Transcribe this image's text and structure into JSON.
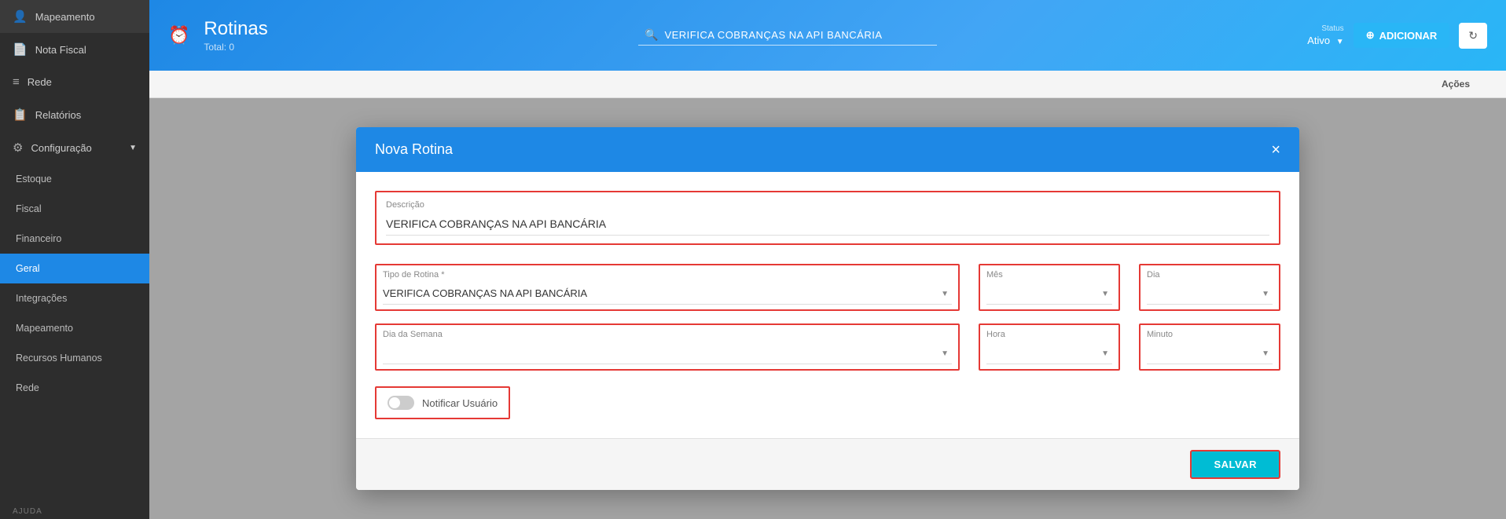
{
  "sidebar": {
    "items": [
      {
        "label": "Mapeamento",
        "icon": "👤",
        "id": "mapeamento-top"
      },
      {
        "label": "Nota Fiscal",
        "icon": "📄",
        "id": "nota-fiscal"
      },
      {
        "label": "Rede",
        "icon": "≡",
        "id": "rede-top"
      },
      {
        "label": "Relatórios",
        "icon": "📋",
        "id": "relatorios"
      },
      {
        "label": "Configuração",
        "icon": "⚙",
        "id": "configuracao"
      },
      {
        "label": "Estoque",
        "icon": "",
        "id": "estoque",
        "sub": true
      },
      {
        "label": "Fiscal",
        "icon": "",
        "id": "fiscal",
        "sub": true
      },
      {
        "label": "Financeiro",
        "icon": "",
        "id": "financeiro",
        "sub": true
      },
      {
        "label": "Geral",
        "icon": "",
        "id": "geral",
        "sub": true,
        "active": true
      },
      {
        "label": "Integrações",
        "icon": "",
        "id": "integracoes",
        "sub": true
      },
      {
        "label": "Mapeamento",
        "icon": "",
        "id": "mapeamento-sub",
        "sub": true
      },
      {
        "label": "Recursos Humanos",
        "icon": "",
        "id": "rh",
        "sub": true
      },
      {
        "label": "Rede",
        "icon": "",
        "id": "rede-sub",
        "sub": true
      }
    ],
    "help_section": "AJUDA"
  },
  "header": {
    "icon": "⏰",
    "title": "Rotinas",
    "subtitle": "Total: 0",
    "search_text": "VERIFICA COBRANÇAS NA API BANCÁRIA",
    "status_label": "Status",
    "status_value": "Ativo",
    "add_button": "ADICIONAR",
    "refresh_icon": "↻"
  },
  "table": {
    "columns": [
      "Ações"
    ]
  },
  "modal": {
    "title": "Nova Rotina",
    "close_icon": "×",
    "form": {
      "descricao_label": "Descrição",
      "descricao_value": "VERIFICA COBRANÇAS NA API BANCÁRIA",
      "tipo_label": "Tipo de Rotina *",
      "tipo_value": "VERIFICA COBRANÇAS NA API BANCÁRIA",
      "mes_label": "Mês",
      "dia_label": "Dia",
      "dia_semana_label": "Dia da Semana",
      "hora_label": "Hora",
      "minuto_label": "Minuto",
      "notificar_label": "Notificar Usuário"
    },
    "save_button": "SALVAR"
  }
}
